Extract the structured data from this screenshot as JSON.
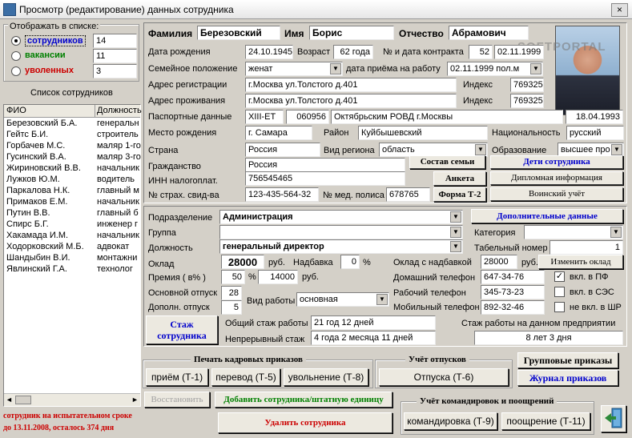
{
  "window": {
    "title": "Просмотр (редактирование) данных сотрудника",
    "close": "×"
  },
  "filter": {
    "title": "Отображать в списке:",
    "options": [
      {
        "label": "сотрудников",
        "count": "14",
        "color": "#0000cc",
        "selected": true
      },
      {
        "label": "вакансии",
        "count": "11",
        "color": "#008000",
        "selected": false
      },
      {
        "label": "уволенных",
        "count": "3",
        "color": "#cc0000",
        "selected": false
      }
    ]
  },
  "list": {
    "title": "Список сотрудников",
    "headers": [
      "ФИО",
      "Должность"
    ],
    "rows": [
      [
        "Березовский Б.А.",
        "генеральн"
      ],
      [
        "Гейтс Б.И.",
        "строитель"
      ],
      [
        "Горбачев М.С.",
        "маляр 1-го"
      ],
      [
        "Гусинский В.А.",
        "маляр 3-го"
      ],
      [
        "Жириновский В.В.",
        "начальник"
      ],
      [
        "Лужков Ю.М.",
        "водитель"
      ],
      [
        "Паркалова Н.К.",
        "главный м"
      ],
      [
        "Примаков Е.М.",
        "начальник"
      ],
      [
        "Путин В.В.",
        "главный б"
      ],
      [
        "Спирс Б.Г.",
        "инженер г"
      ],
      [
        "Хакамада И.М.",
        "начальник"
      ],
      [
        "Ходорковский М.Б.",
        "адвокат"
      ],
      [
        "Шандыбин В.И.",
        "монтажни"
      ],
      [
        "Явлинский Г.А.",
        "технолог"
      ]
    ]
  },
  "person": {
    "lastname_label": "Фамилия",
    "lastname": "Березовский",
    "firstname_label": "Имя",
    "firstname": "Борис",
    "patronymic_label": "Отчество",
    "patronymic": "Абрамович",
    "birth_label": "Дата рождения",
    "birth": "24.10.1945",
    "age_label": "Возраст",
    "age": "62 года",
    "contract_label": "№ и дата контракта",
    "contract_no": "52",
    "contract_date": "02.11.1999",
    "family_label": "Семейное положение",
    "family": "женат",
    "hire_label": "дата приёма на работу",
    "hire": "02.11.1999 пол.м",
    "reg_label": "Адрес регистрации",
    "reg_addr": "г.Москва ул.Толстого д.401",
    "index_label": "Индекс",
    "reg_index": "769325",
    "live_label": "Адрес проживания",
    "live_addr": "г.Москва ул.Толстого д.401",
    "live_index": "769325",
    "passport_label": "Паспортные данные",
    "passport_series": "XIII-ET",
    "passport_no": "060956",
    "passport_issuer": "Октябрьским РОВД г.Москвы",
    "passport_date": "18.04.1993",
    "birthplace_label": "Место рождения",
    "birthplace": "г. Самара",
    "district_label": "Район",
    "district": "Куйбышевский",
    "nationality_label": "Национальность",
    "nationality": "русский",
    "country_label": "Страна",
    "country": "Россия",
    "regiontype_label": "Вид региона",
    "regiontype": "область",
    "education_label": "Образование",
    "education": "высшее про",
    "citizenship_label": "Гражданство",
    "citizenship": "Россия",
    "inn_label": "ИНН налогоплат.",
    "inn": "756545465",
    "insurance_label": "№ страх. свид-ва",
    "insurance": "123-435-564-32",
    "medpolicy_label": "№ мед. полиса",
    "medpolicy": "678765"
  },
  "person_buttons": {
    "family": "Состав семьи",
    "children": "Дети сотрудника",
    "survey": "Анкета",
    "diploma": "Дипломная информация",
    "t2": "Форма Т-2",
    "military": "Воинский учёт"
  },
  "job": {
    "dept_label": "Подразделение",
    "dept": "Администрация",
    "extra_btn": "Дополнительные данные",
    "group_label": "Группа",
    "group": "",
    "category_label": "Категория",
    "category": "",
    "position_label": "Должность",
    "position": "генеральный директор",
    "tabno_label": "Табельный номер",
    "tabno": "1",
    "salary_label": "Оклад",
    "salary": "28000",
    "rub": "руб.",
    "bonus_label": "Надбавка",
    "bonus": "0",
    "pct": "%",
    "salary_total_label": "Оклад с надбавкой",
    "salary_total": "28000",
    "change_btn": "Изменить оклад",
    "premium_label": "Премия ( в% )",
    "premium_pct": "50",
    "premium_sum": "14000",
    "home_phone_label": "Домашний телефон",
    "home_phone": "647-34-76",
    "pf_label": "вкл. в ПФ",
    "pf": true,
    "vacation_label": "Основной отпуск",
    "vacation": "28",
    "work_phone_label": "Рабочий телефон",
    "work_phone": "345-73-23",
    "sez_label": "вкл. в СЭС",
    "sez": false,
    "addvac_label": "Дополн. отпуск",
    "addvac": "5",
    "worktype_label": "Вид работы",
    "worktype": "основная",
    "mobile_label": "Мобильный телефон",
    "mobile": "892-32-46",
    "shr_label": "не вкл. в ШР",
    "shr": false
  },
  "experience": {
    "btn": "Стаж сотрудника",
    "total_label": "Общий стаж работы",
    "total": "21 год 12 дней",
    "cont_label": "Непрерывный стаж",
    "cont": "4 года 2 месяца 11 дней",
    "company_label": "Стаж работы на данном предприятии",
    "company": "8 лет 3 дня"
  },
  "orders": {
    "title": "Печать кадровых приказов",
    "hire": "приём (Т-1)",
    "transfer": "перевод (Т-5)",
    "dismiss": "увольнение (Т-8)"
  },
  "vacations": {
    "title": "Учёт отпусков",
    "btn": "Отпуска (Т-6)"
  },
  "group_orders": "Групповые приказы",
  "journal": "Журнал приказов",
  "restore": "Восстановить",
  "add": "Добавить сотрудника/штатную единицу",
  "delete": "Удалить сотрудника",
  "trips": {
    "title": "Учёт командировок и поощрений",
    "trip": "командировка (Т-9)",
    "reward": "поощрение (Т-11)"
  },
  "status": {
    "line1": "сотрудник на испытательном сроке",
    "line2": "до 13.11.2008, осталось  374 дня"
  },
  "watermark": "SOFTPORTAL"
}
